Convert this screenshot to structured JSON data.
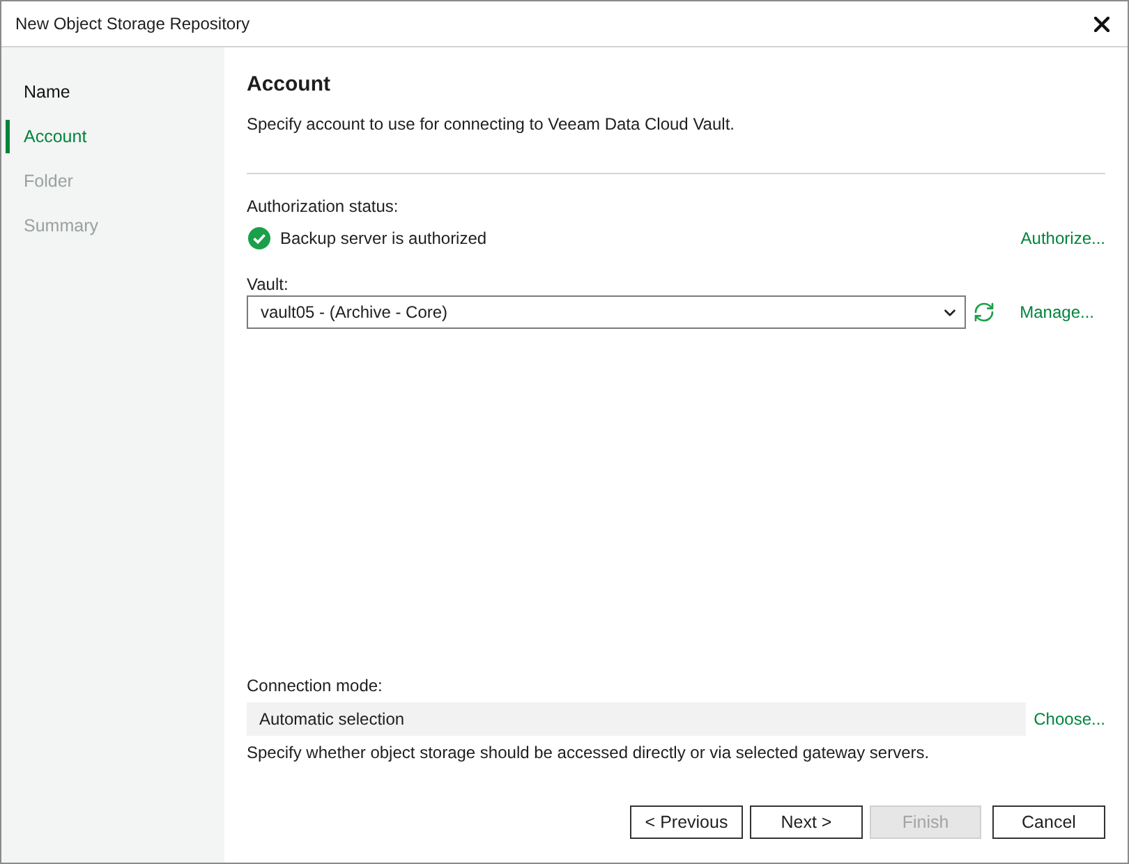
{
  "window": {
    "title": "New Object Storage Repository"
  },
  "steps": [
    {
      "label": "Name",
      "selected": false,
      "disabled": false
    },
    {
      "label": "Account",
      "selected": true,
      "disabled": false
    },
    {
      "label": "Folder",
      "selected": false,
      "disabled": true
    },
    {
      "label": "Summary",
      "selected": false,
      "disabled": true
    }
  ],
  "page": {
    "title": "Account",
    "description": "Specify account to use for connecting to Veeam Data Cloud Vault."
  },
  "authorization": {
    "label": "Authorization status:",
    "status": "Backup server is authorized",
    "authorized": true,
    "link": "Authorize..."
  },
  "vault": {
    "label": "Vault:",
    "value": "vault05 - (Archive - Core)",
    "link": "Manage..."
  },
  "connection_mode": {
    "label": "Connection mode:",
    "value": "Automatic selection",
    "link": "Choose...",
    "hint": "Specify whether object storage should be accessed directly or via selected gateway servers."
  },
  "buttons": [
    {
      "label": "< Previous",
      "disabled": false
    },
    {
      "label": "Next >",
      "disabled": false
    },
    {
      "label": "Finish",
      "disabled": true
    },
    {
      "label": "Cancel",
      "disabled": false
    }
  ]
}
